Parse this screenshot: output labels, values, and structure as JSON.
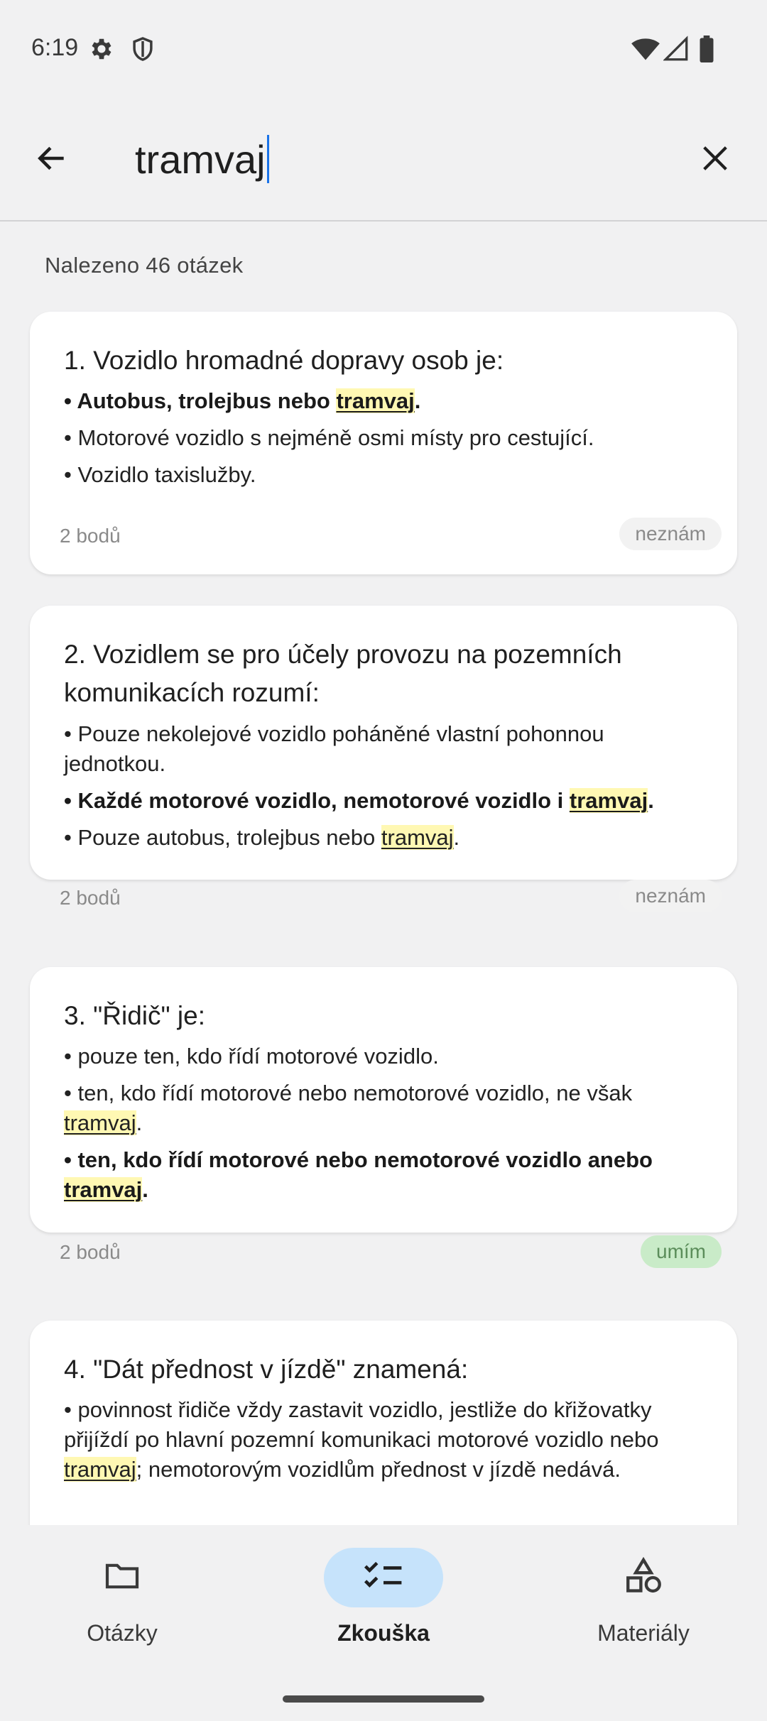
{
  "status_bar": {
    "time": "6:19",
    "icons": [
      "gear-icon",
      "shield-icon",
      "wifi-icon",
      "cellular-signal-icon",
      "battery-icon"
    ]
  },
  "search": {
    "query": "tramvaj",
    "back_icon": "arrow-left-icon",
    "clear_icon": "close-icon"
  },
  "results": {
    "count_label": "Nalezeno 46 otázek",
    "highlight_term": "tramvaj",
    "questions": [
      {
        "title": "1. Vozidlo hromadné dopravy osob je:",
        "answers": [
          {
            "text": "Autobus, trolejbus nebo tramvaj.",
            "correct": true
          },
          {
            "text": "Motorové vozidlo s nejméně osmi místy pro cestující.",
            "correct": false
          },
          {
            "text": "Vozidlo taxislužby.",
            "correct": false
          }
        ],
        "points": "2 bodů",
        "status": "neznám"
      },
      {
        "title": "2. Vozidlem se pro účely provozu na pozemních komunikacích rozumí:",
        "answers": [
          {
            "text": "Pouze nekolejové vozidlo poháněné vlastní pohonnou jednotkou.",
            "correct": false
          },
          {
            "text": "Každé motorové vozidlo, nemotorové vozidlo i tramvaj.",
            "correct": true
          },
          {
            "text": "Pouze autobus, trolejbus nebo tramvaj.",
            "correct": false
          }
        ],
        "points": "2 bodů",
        "status": "neznám"
      },
      {
        "title": "3. \"Řidič\" je:",
        "answers": [
          {
            "text": "pouze ten, kdo řídí motorové vozidlo.",
            "correct": false
          },
          {
            "text": "ten, kdo řídí motorové nebo nemotorové vozidlo, ne však tramvaj.",
            "correct": false
          },
          {
            "text": "ten, kdo řídí motorové nebo nemotorové vozidlo anebo tramvaj.",
            "correct": true
          }
        ],
        "points": "2 bodů",
        "status": "umím"
      },
      {
        "title": "4. \"Dát přednost v jízdě\" znamená:",
        "answers": [
          {
            "text": "povinnost řidiče vždy zastavit vozidlo, jestliže do křižovatky přijíždí po hlavní pozemní komunikaci motorové vozidlo nebo tramvaj; nemotorovým vozidlům přednost v jízdě nedává.",
            "correct": false
          }
        ]
      }
    ]
  },
  "bottom_nav": {
    "items": [
      {
        "label": "Otázky",
        "icon": "folder-icon",
        "active": false
      },
      {
        "label": "Zkouška",
        "icon": "checklist-icon",
        "active": true
      },
      {
        "label": "Materiály",
        "icon": "shapes-icon",
        "active": false
      }
    ]
  },
  "colors": {
    "background": "#f1f1f2",
    "card": "#ffffff",
    "highlight": "#fff8b3",
    "known_badge": "#c9ebc8",
    "active_nav_pill": "#c6e3fb",
    "caret": "#1a73e8"
  }
}
